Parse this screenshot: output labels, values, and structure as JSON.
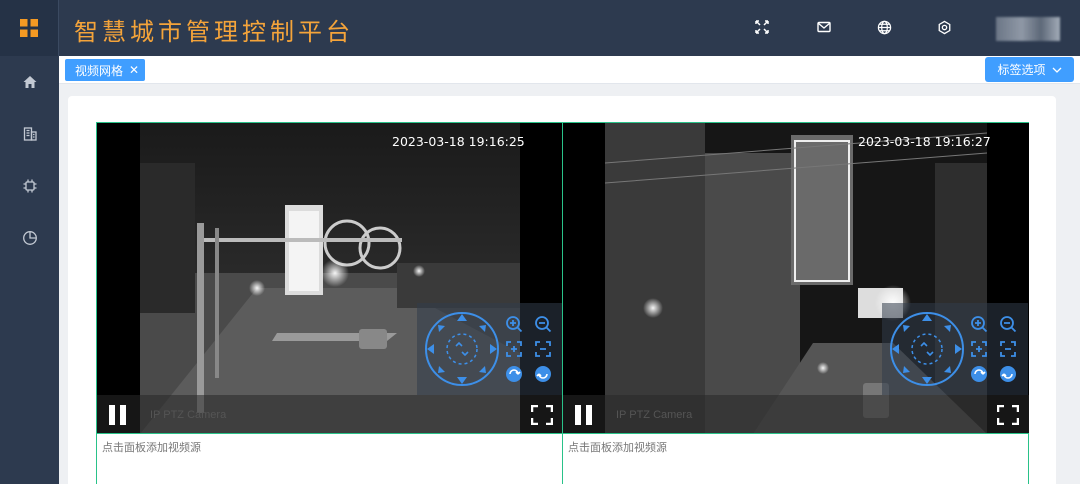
{
  "header": {
    "title": "智慧城市管理控制平台",
    "icons": [
      "fullscreen-icon",
      "mail-icon",
      "globe-icon",
      "settings-icon"
    ],
    "accent": "#f5a43a",
    "background": "#2d3a4f"
  },
  "sidebar": {
    "items": [
      "home-icon",
      "building-icon",
      "chip-icon",
      "pie-chart-icon"
    ]
  },
  "tabs": {
    "active_label": "视频网格",
    "close_glyph": "✕",
    "options_label": "标签选项"
  },
  "videos": [
    {
      "timestamp": "2023-03-18 19:16:25",
      "camera_name": "IP PTZ Camera",
      "placeholder": "点击面板添加视频源"
    },
    {
      "timestamp": "2023-03-18 19:16:27",
      "camera_name": "IP PTZ Camera",
      "placeholder": "点击面板添加视频源"
    }
  ],
  "colors": {
    "primary": "#409eff",
    "grid_border": "#29c289",
    "ptz": "#3d8fe8"
  }
}
